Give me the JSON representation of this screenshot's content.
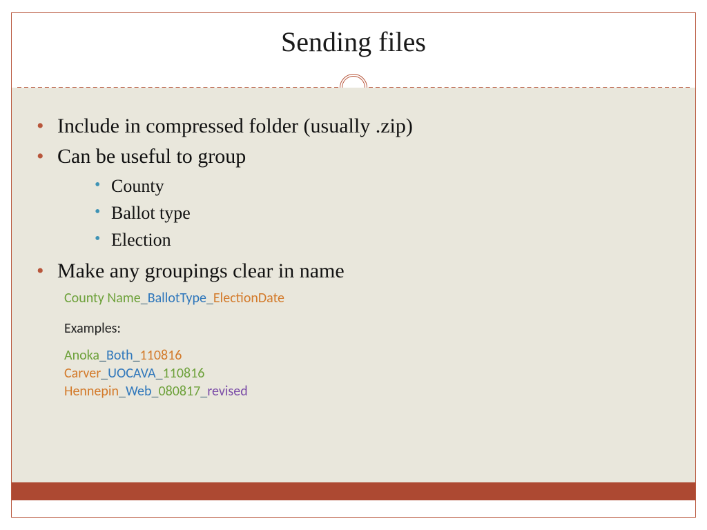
{
  "title": "Sending files",
  "bullets": {
    "b1": "Include in compressed folder (usually .zip)",
    "b2": "Can be useful to group",
    "sub1": "County",
    "sub2": "Ballot type",
    "sub3": "Election",
    "b3": "Make any groupings clear in name"
  },
  "pattern": {
    "p1": "County Name",
    "u1": "_",
    "p2": "BallotType",
    "u2": "_",
    "p3": "ElectionDate"
  },
  "examples_label": "Examples:",
  "ex1": {
    "a": "Anoka",
    "u1": "_",
    "b": "Both",
    "u2": "_",
    "c": "110816"
  },
  "ex2": {
    "a": "Carver",
    "u1": "_",
    "b": "UOCAVA",
    "u2": "_",
    "c": "110816"
  },
  "ex3": {
    "a": "Hennepin",
    "u1": "_",
    "b": "Web",
    "u2": "_",
    "c": "080817",
    "u3": "_",
    "d": "revised"
  }
}
